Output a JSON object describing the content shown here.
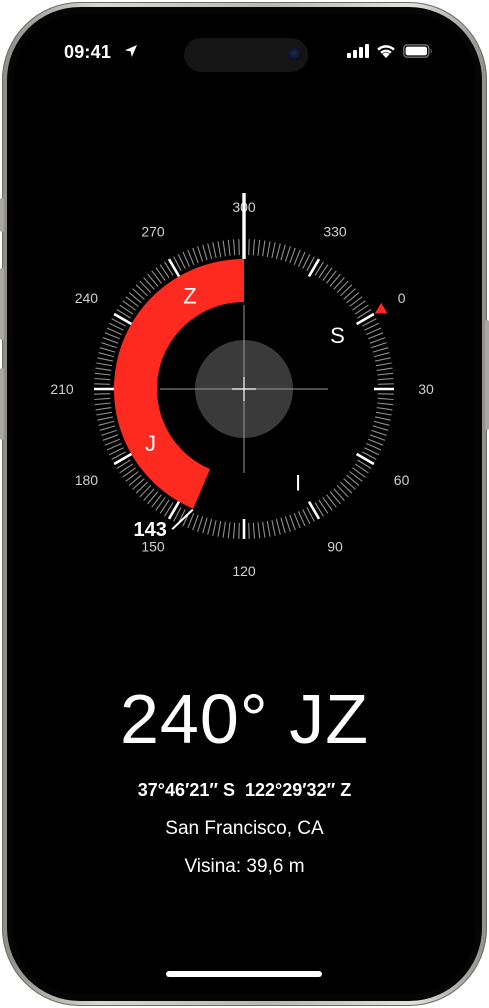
{
  "status_bar": {
    "time": "09:41",
    "icons": [
      "location-arrow-icon",
      "cellular-signal-icon",
      "wifi-icon",
      "battery-icon"
    ]
  },
  "compass": {
    "heading_degrees": 240,
    "bearing_degrees": 143,
    "bearing_label": "143",
    "accent_color": "#ff2a1f",
    "degree_labels": [
      "0",
      "30",
      "60",
      "90",
      "120",
      "150",
      "180",
      "210",
      "240",
      "270",
      "300",
      "330"
    ],
    "cardinals": {
      "north": "S",
      "east": "I",
      "south": "J",
      "west": "Z"
    }
  },
  "readout": {
    "heading": "240° JZ",
    "coordinates": "37°46′21″ S  122°29′32″ Z",
    "city": "San Francisco, CA",
    "elevation": "Visina: 39,6 m"
  }
}
